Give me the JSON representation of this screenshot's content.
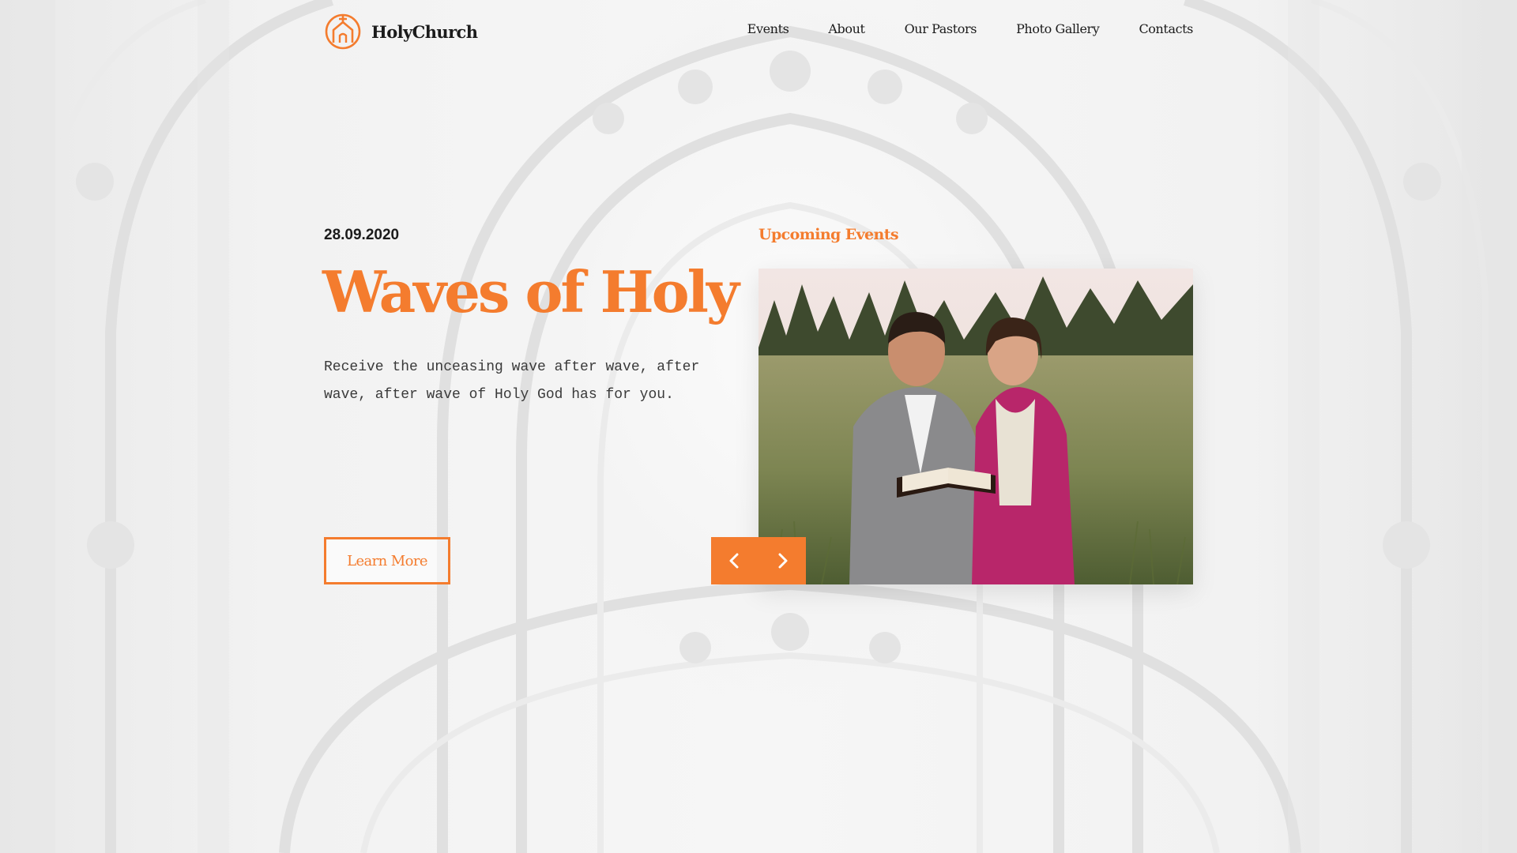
{
  "brand": {
    "name": "HolyChurch",
    "accent": "#f47c2e"
  },
  "nav": {
    "items": [
      {
        "label": "Events"
      },
      {
        "label": "About"
      },
      {
        "label": "Our Pastors"
      },
      {
        "label": "Photo Gallery"
      },
      {
        "label": "Contacts"
      }
    ]
  },
  "hero": {
    "date": "28.09.2020",
    "title": "Waves of Holy",
    "description": "Receive the unceasing wave after wave, after wave, after wave of Holy God has for you.",
    "cta_label": "Learn More"
  },
  "events": {
    "heading": "Upcoming Events",
    "photo_alt": "Couple reading a bible in a meadow",
    "prev_icon": "chevron-left-icon",
    "next_icon": "chevron-right-icon"
  }
}
